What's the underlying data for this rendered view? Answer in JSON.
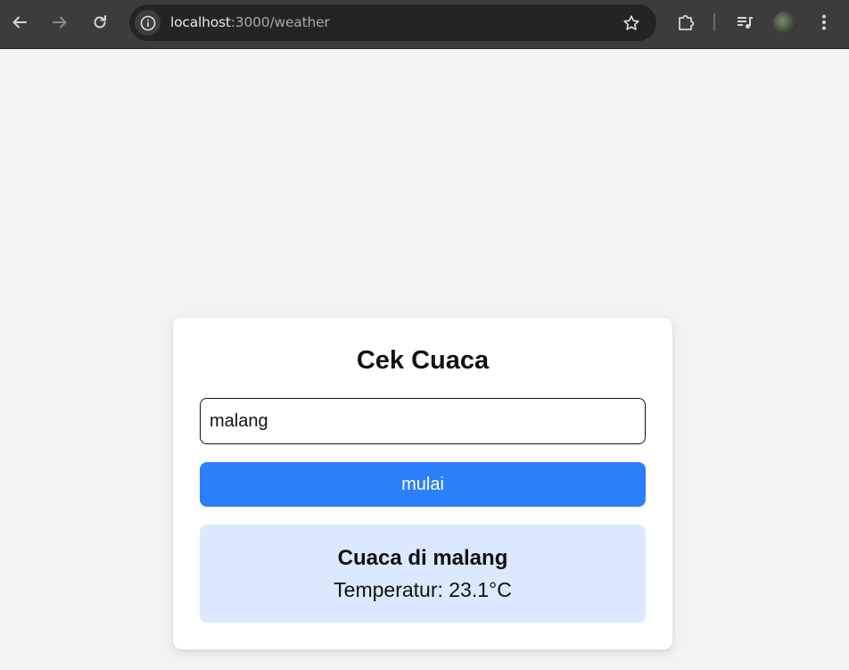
{
  "browser": {
    "url_host": "localhost",
    "url_path": ":3000/weather"
  },
  "icons": {
    "back": "arrow-left-icon",
    "forward": "arrow-right-icon",
    "reload": "reload-icon",
    "site_info": "info-icon",
    "bookmark": "star-icon",
    "extensions": "puzzle-icon",
    "media": "media-control-icon",
    "profile": "avatar",
    "menu": "kebab-menu-icon"
  },
  "colors": {
    "page_bg": "#f2f3f5",
    "card_bg": "#ffffff",
    "button_bg": "#2b7ffb",
    "result_bg": "#dbe8fd"
  },
  "app": {
    "title": "Cek Cuaca",
    "city_input_value": "malang",
    "submit_label": "mulai",
    "result_title": "Cuaca di malang",
    "result_temperature": "Temperatur: 23.1°C"
  }
}
